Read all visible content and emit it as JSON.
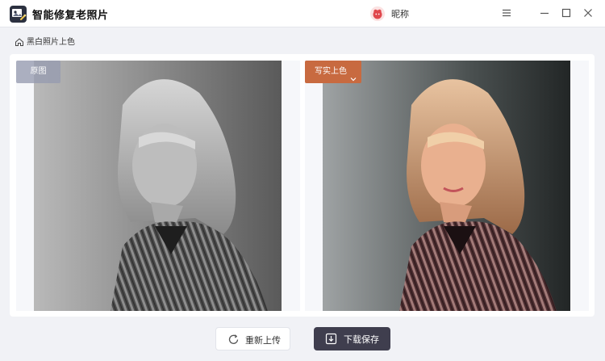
{
  "window": {
    "title": "智能修复老照片",
    "user_name": "昵称",
    "logo_icon": "photo-restore-logo",
    "avatar_icon": "cartoon-avatar-icon"
  },
  "window_controls": [
    "menu-icon",
    "minimize-icon",
    "maximize-icon",
    "close-icon"
  ],
  "breadcrumb": {
    "icon": "home-icon",
    "label": "黑白照片上色"
  },
  "comparison": {
    "original_tag": "原图",
    "style_tag": "写实上色",
    "style_tag_color": "#c86a40"
  },
  "actions": {
    "reupload_label": "重新上传",
    "download_label": "下载保存",
    "download_color": "#3f3e4e"
  }
}
